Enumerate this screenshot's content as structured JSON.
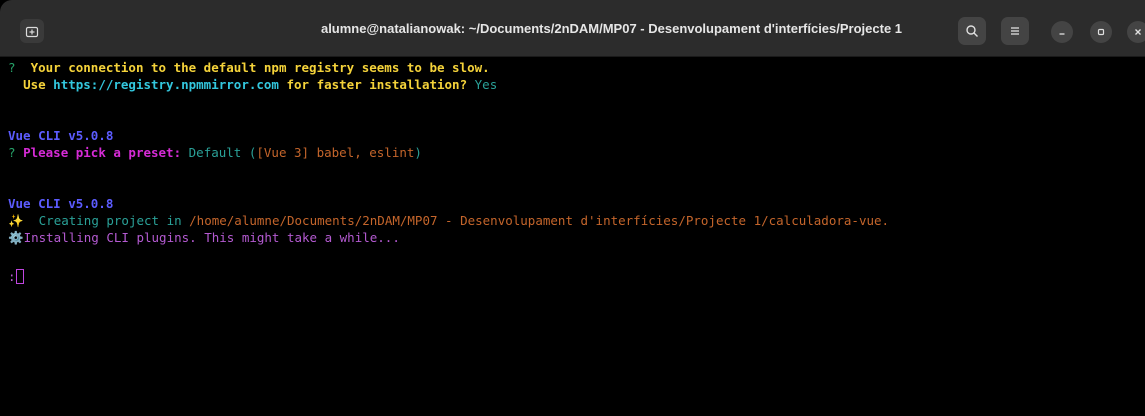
{
  "window": {
    "title": "alumne@natalianowak: ~/Documents/2nDAM/MP07 - Desenvolupament d'interfícies/Projecte 1"
  },
  "icons": {
    "new_tab": "new-tab-icon",
    "search": "search-icon",
    "menu": "hamburger-menu-icon",
    "minimize": "minimize-icon",
    "maximize": "maximize-icon",
    "close": "close-icon"
  },
  "terminal": {
    "prompt1": {
      "mark": "?",
      "question_line1": "Your connection to the default npm registry seems to be slow.",
      "question_line2_pre": "Use ",
      "url": "https://registry.npmmirror.com",
      "question_line2_post": " for faster installation?",
      "answer": "Yes"
    },
    "vue_cli_1": "Vue CLI v5.0.8",
    "prompt2": {
      "mark": "?",
      "question": "Please pick a preset:",
      "answer_pre": "Default (",
      "answer_highlight": "[Vue 3] babel, eslint",
      "answer_post": ")"
    },
    "vue_cli_2": "Vue CLI v5.0.8",
    "creating": {
      "emoji": "✨",
      "text": "Creating project in ",
      "path": "/home/alumne/Documents/2nDAM/MP07 - Desenvolupament d'interfícies/Projecte 1/calculadora-vue."
    },
    "installing": {
      "emoji": "⚙️",
      "text": "Installing CLI plugins. This might take a while..."
    },
    "spinner": ":"
  },
  "colors": {
    "background": "#000000",
    "titlebar": "#2c2c2c",
    "prompt_mark": "#26a269",
    "question": "#f5d33a",
    "url": "#33c7de",
    "vue_cli": "#5c5cff",
    "preset_question": "#d62bd6",
    "path": "#c4652b",
    "installing": "#b45ad1"
  }
}
